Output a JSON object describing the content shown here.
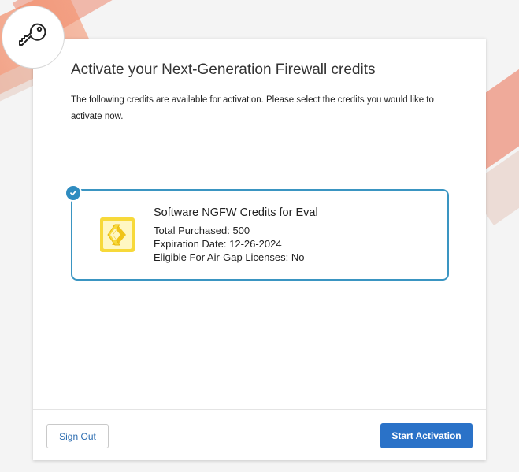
{
  "dialog": {
    "title": "Activate your Next-Generation Firewall credits",
    "description": "The following credits are available for activation. Please select the credits you would like to activate now."
  },
  "credit": {
    "name": "Software NGFW Credits for Eval",
    "total_purchased": "Total Purchased: 500",
    "expiration_date": "Expiration Date: 12-26-2024",
    "air_gap": "Eligible For Air-Gap Licenses: No",
    "selected": true
  },
  "footer": {
    "sign_out_label": "Sign Out",
    "start_activation_label": "Start Activation"
  },
  "icons": {
    "key": "key-icon",
    "check": "check-icon",
    "credit_logo": "ngfw-credit-logo-icon"
  },
  "colors": {
    "accent": "#2a72c8",
    "selected_border": "#3a95c2",
    "logo_yellow": "#f5d224"
  }
}
